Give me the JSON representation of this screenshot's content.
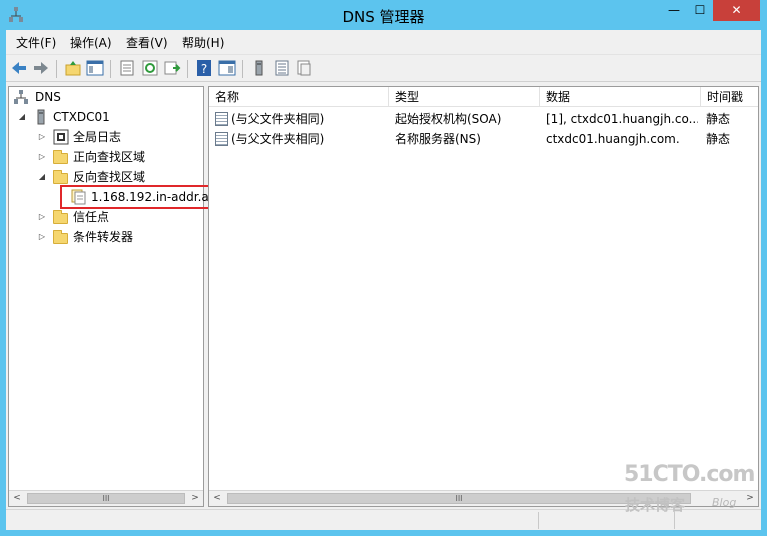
{
  "window": {
    "title": "DNS 管理器",
    "min_glyph": "—",
    "max_glyph": "☐",
    "close_glyph": "✕"
  },
  "menu": [
    "文件(F)",
    "操作(A)",
    "查看(V)",
    "帮助(H)"
  ],
  "tree": {
    "root": "DNS",
    "server": "CTXDC01",
    "items": [
      {
        "label": "全局日志"
      },
      {
        "label": "正向查找区域"
      },
      {
        "label": "反向查找区域"
      },
      {
        "label": "1.168.192.in-addr.a"
      },
      {
        "label": "信任点"
      },
      {
        "label": "条件转发器"
      }
    ]
  },
  "list": {
    "columns": [
      "名称",
      "类型",
      "数据",
      "时间戳"
    ],
    "rows": [
      {
        "name": "(与父文件夹相同)",
        "type": "起始授权机构(SOA)",
        "data": "[1], ctxdc01.huangjh.co...",
        "timestamp": "静态"
      },
      {
        "name": "(与父文件夹相同)",
        "type": "名称服务器(NS)",
        "data": "ctxdc01.huangjh.com.",
        "timestamp": "静态"
      }
    ]
  },
  "scroll": {
    "thumb_glyph": "III",
    "left_arrow": "<",
    "right_arrow": ">"
  },
  "watermark": {
    "logo": "51CTO.com",
    "sub": "技术博客",
    "blog": "Blog"
  },
  "colors": {
    "titlebar": "#5cc4ee",
    "close": "#c8403a",
    "highlight": "#e0272a",
    "folder": "#f5d66f"
  }
}
